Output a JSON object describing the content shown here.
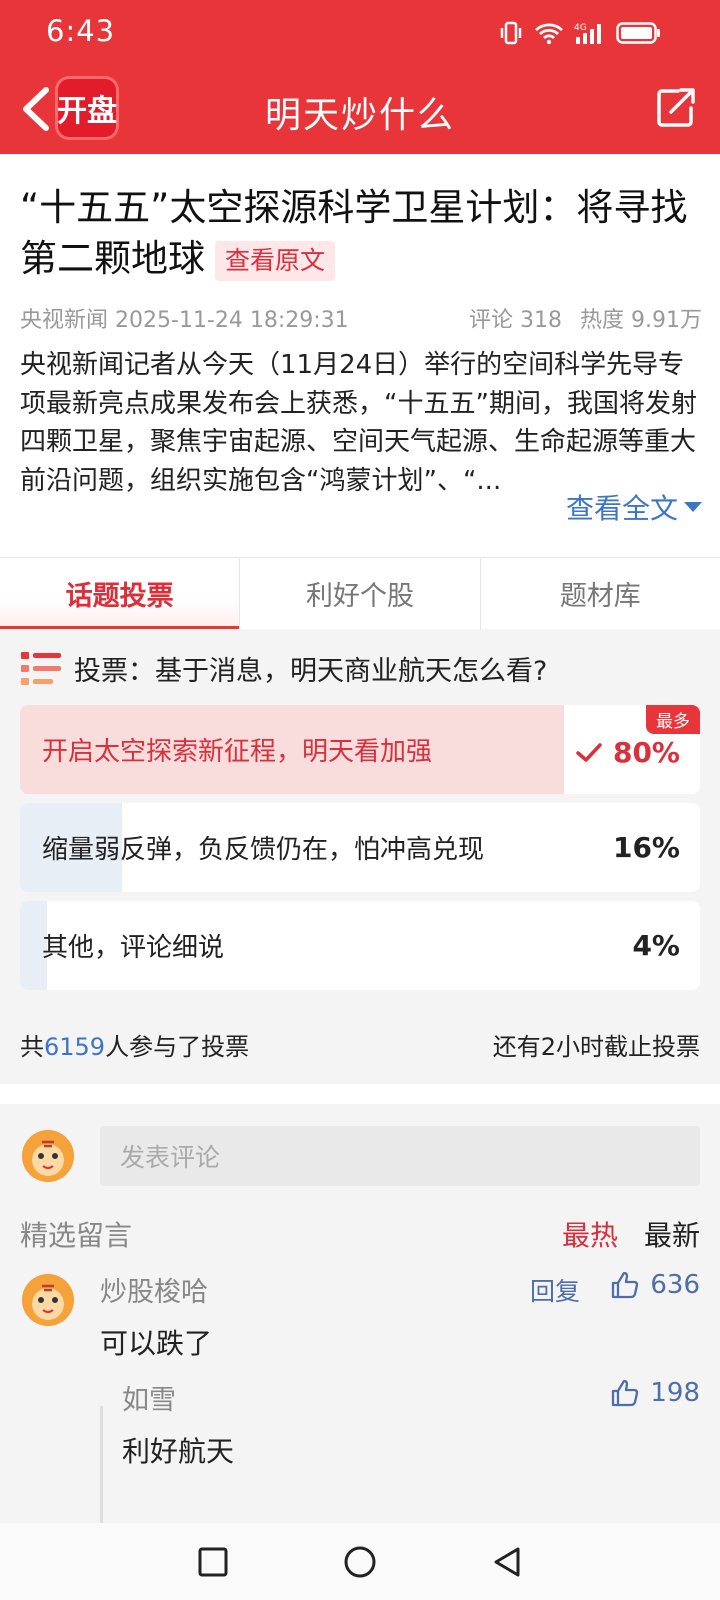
{
  "status_bar": {
    "time": "6:43"
  },
  "header": {
    "logo_text": "开盘",
    "title": "明天炒什么"
  },
  "article": {
    "headline": "“十五五”太空探源科学卫星计划：将寻找第二颗地球",
    "view_original": "查看原文",
    "source": "央视新闻",
    "datetime": "2025-11-24 18:29:31",
    "comments": "评论 318",
    "heat": "热度 9.91万",
    "body": "央视新闻记者从今天（11月24日）举行的空间科学先导专项最新亮点成果发布会上获悉，“十五五”期间，我国将发射四颗卫星，聚焦宇宙起源、空间天气起源、生命起源等重大前沿问题，组织实施包含“鸿蒙计划”、“...",
    "read_more": "查看全文"
  },
  "tabs": [
    {
      "label": "话题投票",
      "active": true
    },
    {
      "label": "利好个股",
      "active": false
    },
    {
      "label": "题材库",
      "active": false
    }
  ],
  "vote": {
    "question": "投票：基于消息，明天商业航天怎么看?",
    "options": [
      {
        "label": "开启太空探索新征程，明天看加强",
        "percent": "80%",
        "ratio": 0.8,
        "badge": "最多",
        "selected": true
      },
      {
        "label": "缩量弱反弹，负反馈仍在，怕冲高兑现",
        "percent": "16%",
        "ratio": 0.16
      },
      {
        "label": "其他，评论细说",
        "percent": "4%",
        "ratio": 0.04
      }
    ],
    "participants_prefix": "共",
    "participants": "6159",
    "participants_suffix": "人参与了投票",
    "deadline": "还有2小时截止投票"
  },
  "comments": {
    "input_placeholder": "发表评论",
    "section_title": "精选留言",
    "sort_hot": "最热",
    "sort_new": "最新",
    "items": [
      {
        "user": "炒股梭哈",
        "text": "可以跌了",
        "reply_label": "回复",
        "likes": "636"
      },
      {
        "user": "如雪",
        "text": "利好航天",
        "likes": "198"
      }
    ]
  },
  "colors": {
    "brand": "#e8353a",
    "link": "#3c75c8"
  }
}
